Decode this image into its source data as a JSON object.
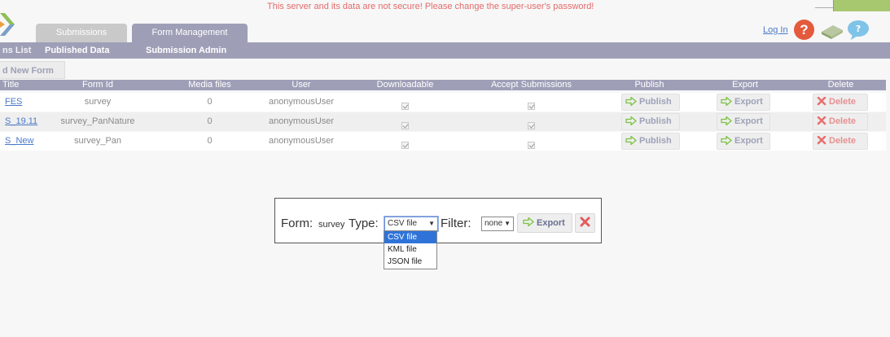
{
  "warning": "This server and its data are not secure! Please change the super-user's password!",
  "tabs": [
    {
      "label": "Submissions"
    },
    {
      "label": "Form Management"
    }
  ],
  "header": {
    "login": "Log In"
  },
  "subnav": [
    "ns List",
    "Published Data",
    "Submission Admin"
  ],
  "add_form_label": "d New Form",
  "table": {
    "columns": [
      "Title",
      "Form Id",
      "Media files",
      "User",
      "Downloadable",
      "Accept Submissions",
      "Publish",
      "Export",
      "Delete"
    ],
    "rows": [
      {
        "title": "FES",
        "form_id": "survey",
        "media": "0",
        "user": "anonymousUser"
      },
      {
        "title": "S_19.11",
        "form_id": "survey_PanNature",
        "media": "0",
        "user": "anonymousUser"
      },
      {
        "title": "S_New",
        "form_id": "survey_Pan",
        "media": "0",
        "user": "anonymousUser"
      }
    ],
    "publish_label": "Publish",
    "export_label": "Export",
    "delete_label": "Delete"
  },
  "export_dialog": {
    "form_label": "Form:",
    "form_value": "survey",
    "type_label": "Type:",
    "type_selected": "CSV file",
    "type_options": [
      "CSV file",
      "KML file",
      "JSON file"
    ],
    "filter_label": "Filter:",
    "filter_selected": "none",
    "export_button": "Export"
  },
  "colors": {
    "accent": "#9e9fb7",
    "warning": "#e36b6b",
    "link": "#4a79c8",
    "selected_option": "#2f73d9"
  }
}
